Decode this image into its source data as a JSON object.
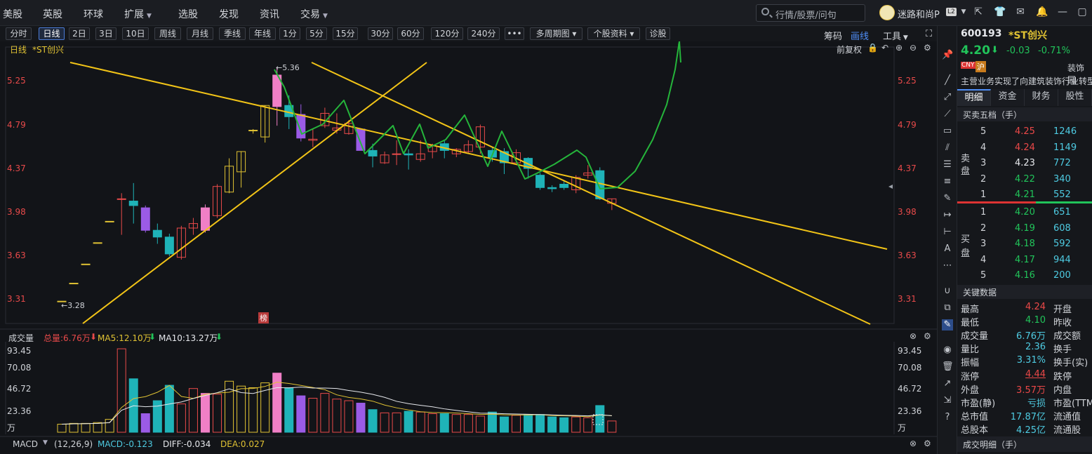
{
  "nav": {
    "items": [
      {
        "label": "美股",
        "caret": false
      },
      {
        "label": "英股",
        "caret": false
      },
      {
        "label": "环球",
        "caret": false
      },
      {
        "label": "扩展",
        "caret": true
      },
      {
        "label": "选股",
        "caret": false
      },
      {
        "label": "发现",
        "caret": false
      },
      {
        "label": "资讯",
        "caret": false
      },
      {
        "label": "交易",
        "caret": true
      }
    ],
    "search_placeholder": "行情/股票/问句",
    "username": "迷路和尚P",
    "badge": "L2"
  },
  "toolbar": {
    "periods": [
      "分时",
      "日线",
      "2日",
      "3日",
      "10日",
      "周线",
      "月线",
      "季线",
      "年线",
      "1分",
      "5分",
      "15分",
      "30分",
      "60分",
      "120分",
      "240分",
      "•••",
      "多周期图",
      "个股资料",
      "诊股"
    ],
    "active": "日线",
    "right": {
      "chips": "筹码",
      "draw": "画线",
      "tools": "工具"
    }
  },
  "chart": {
    "period_label": "日线",
    "stock_label": "*ST创兴",
    "adjust_label": "前复权",
    "high_marker": "←5.36",
    "low_marker": "←3.28",
    "list_tag": "榜",
    "price_ticks": [
      "5.25",
      "4.79",
      "4.37",
      "3.98",
      "3.63",
      "3.31"
    ],
    "volume": {
      "title": "成交量",
      "total": "总量:6.76万",
      "ma5": "MA5:12.10万",
      "ma10": "MA10:13.27万",
      "ticks": [
        "93.45",
        "70.08",
        "46.72",
        "23.36",
        "万"
      ]
    },
    "macd": {
      "title": "MACD",
      "params": "(12,26,9)",
      "macd": "MACD:-0.123",
      "diff": "DIFF:-0.034",
      "dea": "DEA:0.027"
    },
    "colors": {
      "up": "#e84a4a",
      "down": "#1fb3b8",
      "ma_yellow": "#e0c233",
      "trend": "#f2c417",
      "hand": "#25b53b",
      "purple": "#9b5be6",
      "pink": "#f07fc6"
    }
  },
  "chart_data": {
    "type": "candlestick",
    "candles": [
      {
        "o": 3.29,
        "c": 3.29,
        "h": 3.29,
        "l": 3.29
      },
      {
        "o": 3.45,
        "c": 3.45,
        "h": 3.45,
        "l": 3.45
      },
      {
        "o": 3.62,
        "c": 3.62,
        "h": 3.62,
        "l": 3.62
      },
      {
        "o": 3.81,
        "c": 3.81,
        "h": 3.81,
        "l": 3.81
      },
      {
        "o": 4.0,
        "c": 4.0,
        "h": 4.0,
        "l": 4.0
      },
      {
        "o": 4.2,
        "c": 4.2,
        "h": 4.25,
        "l": 3.88
      },
      {
        "o": 4.18,
        "c": 4.14,
        "h": 4.34,
        "l": 3.98
      },
      {
        "o": 4.12,
        "c": 3.92,
        "h": 4.14,
        "l": 3.9
      },
      {
        "o": 3.92,
        "c": 3.86,
        "h": 3.98,
        "l": 3.8
      },
      {
        "o": 3.86,
        "c": 3.71,
        "h": 3.89,
        "l": 3.69
      },
      {
        "o": 3.68,
        "c": 3.94,
        "h": 3.96,
        "l": 3.66
      },
      {
        "o": 3.94,
        "c": 3.98,
        "h": 4.03,
        "l": 3.88
      },
      {
        "o": 3.92,
        "c": 4.12,
        "h": 4.15,
        "l": 3.9
      },
      {
        "o": 4.05,
        "c": 4.31,
        "h": 4.33,
        "l": 4.03
      },
      {
        "o": 4.26,
        "c": 4.49,
        "h": 4.56,
        "l": 4.25
      },
      {
        "o": 4.44,
        "c": 4.62,
        "h": 4.62,
        "l": 4.3
      },
      {
        "o": 4.81,
        "c": 4.81,
        "h": 4.82,
        "l": 4.78
      },
      {
        "o": 4.75,
        "c": 5.03,
        "h": 5.03,
        "l": 4.7
      },
      {
        "o": 5.02,
        "c": 5.3,
        "h": 5.36,
        "l": 4.85
      },
      {
        "o": 5.03,
        "c": 4.93,
        "h": 5.12,
        "l": 4.82
      },
      {
        "o": 4.95,
        "c": 4.74,
        "h": 5.04,
        "l": 4.71
      },
      {
        "o": 4.72,
        "c": 4.73,
        "h": 4.82,
        "l": 4.66
      },
      {
        "o": 4.85,
        "c": 4.96,
        "h": 5.01,
        "l": 4.83
      },
      {
        "o": 4.81,
        "c": 4.83,
        "h": 4.96,
        "l": 4.78
      },
      {
        "o": 4.78,
        "c": 4.87,
        "h": 4.9,
        "l": 4.77
      },
      {
        "o": 4.82,
        "c": 4.63,
        "h": 4.82,
        "l": 4.63
      },
      {
        "o": 4.63,
        "c": 4.58,
        "h": 4.69,
        "l": 4.48
      },
      {
        "o": 4.52,
        "c": 4.59,
        "h": 4.62,
        "l": 4.51
      },
      {
        "o": 4.6,
        "c": 4.6,
        "h": 4.72,
        "l": 4.5
      },
      {
        "o": 4.6,
        "c": 4.59,
        "h": 4.64,
        "l": 4.46
      },
      {
        "o": 4.55,
        "c": 4.6,
        "h": 4.72,
        "l": 4.53
      },
      {
        "o": 4.62,
        "c": 4.67,
        "h": 4.69,
        "l": 4.56
      },
      {
        "o": 4.69,
        "c": 4.63,
        "h": 4.72,
        "l": 4.56
      },
      {
        "o": 4.6,
        "c": 4.64,
        "h": 4.65,
        "l": 4.57
      },
      {
        "o": 4.62,
        "c": 4.68,
        "h": 4.72,
        "l": 4.61
      },
      {
        "o": 4.66,
        "c": 4.84,
        "h": 4.86,
        "l": 4.6
      },
      {
        "o": 4.63,
        "c": 4.57,
        "h": 4.66,
        "l": 4.53
      },
      {
        "o": 4.62,
        "c": 4.52,
        "h": 4.65,
        "l": 4.42
      },
      {
        "o": 4.52,
        "c": 4.61,
        "h": 4.64,
        "l": 4.52
      },
      {
        "o": 4.56,
        "c": 4.47,
        "h": 4.57,
        "l": 4.38
      },
      {
        "o": 4.41,
        "c": 4.3,
        "h": 4.43,
        "l": 4.28
      },
      {
        "o": 4.3,
        "c": 4.29,
        "h": 4.32,
        "l": 4.26
      },
      {
        "o": 4.33,
        "c": 4.3,
        "h": 4.36,
        "l": 4.28
      },
      {
        "o": 4.28,
        "c": 4.39,
        "h": 4.41,
        "l": 4.25
      },
      {
        "o": 4.41,
        "c": 4.43,
        "h": 4.5,
        "l": 4.38
      },
      {
        "o": 4.45,
        "c": 4.2,
        "h": 4.48,
        "l": 4.19
      },
      {
        "o": 4.16,
        "c": 4.2,
        "h": 4.2,
        "l": 4.1
      }
    ],
    "volumes": [
      3,
      4,
      4,
      5,
      9,
      96,
      59,
      16,
      32,
      51,
      28,
      47,
      41,
      40,
      56,
      50,
      48,
      54,
      66,
      48,
      38,
      35,
      41,
      34,
      32,
      29,
      21,
      17,
      17,
      19,
      18,
      16,
      16,
      15,
      15,
      13,
      18,
      12,
      14,
      15,
      15,
      12,
      11,
      12,
      11,
      26,
      7
    ],
    "price_range": [
      3.2,
      5.4
    ],
    "volume_range": [
      0,
      100
    ]
  },
  "stock": {
    "code": "600193",
    "name": "*ST创兴",
    "price": "4.20",
    "change": "-0.03",
    "change_pct": "-0.71%",
    "tag1": "CNY",
    "tag2": "沪",
    "industry": "装饰园",
    "desc": "主营业务实现了向建筑装饰行业转型"
  },
  "panel_tabs": [
    "明细",
    "资金",
    "财务",
    "股性"
  ],
  "orderbook": {
    "title": "买卖五档（手）",
    "sell_label": [
      "卖",
      "盘"
    ],
    "buy_label": [
      "买",
      "盘"
    ],
    "asks": [
      {
        "level": "5",
        "price": "4.25",
        "vol": "1246",
        "color": "red"
      },
      {
        "level": "4",
        "price": "4.24",
        "vol": "1149",
        "color": "red"
      },
      {
        "level": "3",
        "price": "4.23",
        "vol": "772",
        "color": "white"
      },
      {
        "level": "2",
        "price": "4.22",
        "vol": "340",
        "color": "green"
      },
      {
        "level": "1",
        "price": "4.21",
        "vol": "552",
        "color": "green"
      }
    ],
    "bids": [
      {
        "level": "1",
        "price": "4.20",
        "vol": "651",
        "color": "green"
      },
      {
        "level": "2",
        "price": "4.19",
        "vol": "608",
        "color": "green"
      },
      {
        "level": "3",
        "price": "4.18",
        "vol": "592",
        "color": "green"
      },
      {
        "level": "4",
        "price": "4.17",
        "vol": "944",
        "color": "green"
      },
      {
        "level": "5",
        "price": "4.16",
        "vol": "200",
        "color": "green"
      }
    ]
  },
  "keydata": {
    "title": "关键数据",
    "rows": [
      {
        "k": "最高",
        "v": "4.24",
        "vc": "red",
        "k2": "开盘"
      },
      {
        "k": "最低",
        "v": "4.10",
        "vc": "green",
        "k2": "昨收"
      },
      {
        "k": "成交量",
        "v": "6.76万",
        "vc": "cyan",
        "k2": "成交额"
      },
      {
        "k": "量比",
        "v": "2.36",
        "vc": "cyan",
        "k2": "换手"
      },
      {
        "k": "振幅",
        "v": "3.31%",
        "vc": "cyan",
        "k2": "换手(实)"
      },
      {
        "k": "涨停",
        "v": "4.44",
        "vc": "red",
        "k2": "跌停"
      },
      {
        "k": "外盘",
        "v": "3.57万",
        "vc": "red",
        "k2": "内盘"
      },
      {
        "k": "市盈(静)",
        "v": "亏损",
        "vc": "cyan",
        "k2": "市盈(TTM"
      },
      {
        "k": "总市值",
        "v": "17.87亿",
        "vc": "cyan",
        "k2": "流通值"
      },
      {
        "k": "总股本",
        "v": "4.25亿",
        "vc": "cyan",
        "k2": "流通股"
      }
    ]
  },
  "trades_title": "成交明细（手）"
}
